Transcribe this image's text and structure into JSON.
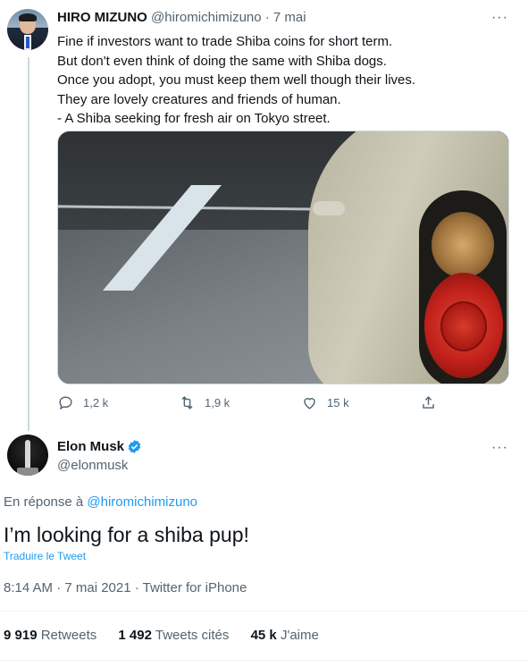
{
  "tweet1": {
    "author_name": "HIRO MIZUNO",
    "handle_time": "@hiromichimizuno · 7 mai",
    "more": "···",
    "lines": [
      "Fine if investors want to trade Shiba coins for short term.",
      "But don't even think of doing the same with Shiba dogs.",
      "Once you adopt, you must keep them well though their lives.",
      "They are lovely creatures and friends of human.",
      "- A Shiba seeking for fresh air on Tokyo street."
    ],
    "replies": "1,2 k",
    "retweets": "1,9 k",
    "likes": "15 k"
  },
  "tweet2": {
    "author_name": "Elon Musk",
    "handle": "@elonmusk",
    "more": "···",
    "reply_prefix": "En réponse à",
    "reply_handle": "@hiromichimizuno",
    "text": "I’m looking for a shiba pup!",
    "translate": "Traduire le Tweet",
    "meta": "8:14 AM · 7 mai 2021 · Twitter for iPhone",
    "stats": {
      "retweets_count": "9 919",
      "retweets_label": "Retweets",
      "quotes_count": "1 492",
      "quotes_label": "Tweets cités",
      "likes_count": "45 k",
      "likes_label": "J'aime"
    }
  },
  "colors": {
    "accent": "#1d9bf0",
    "muted": "#536471",
    "text": "#0f1419"
  },
  "icons": [
    "reply-icon",
    "retweet-icon",
    "like-icon",
    "share-icon",
    "verified-icon",
    "more-icon"
  ]
}
